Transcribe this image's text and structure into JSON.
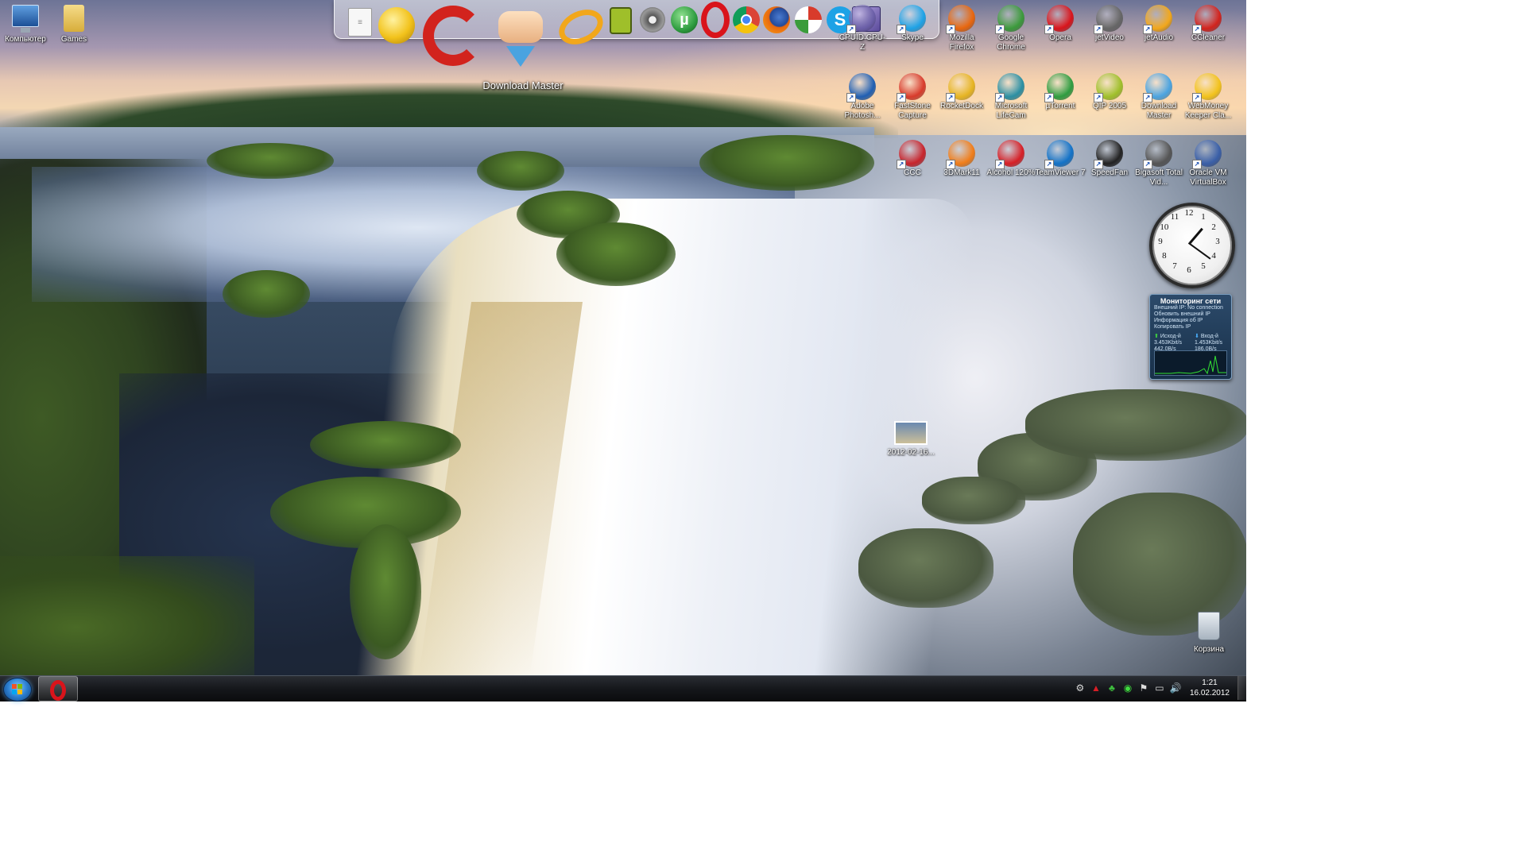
{
  "desktop": {
    "left_icons": [
      {
        "label": "Компьютер",
        "icon": "computer-icon"
      },
      {
        "label": "Games",
        "icon": "folder-icon"
      }
    ],
    "grid_icons": [
      {
        "label": "CPUID CPU-Z",
        "icon": "cpuz-icon",
        "color": "#6b5fa8"
      },
      {
        "label": "Skype",
        "icon": "skype-icon",
        "color": "#1da2e6"
      },
      {
        "label": "Mozilla Firefox",
        "icon": "firefox-icon",
        "color": "#e8660d"
      },
      {
        "label": "Google Chrome",
        "icon": "chrome-icon",
        "color": "#3b9a3b"
      },
      {
        "label": "Opera",
        "icon": "opera-icon",
        "color": "#d9141b"
      },
      {
        "label": "jetVideo",
        "icon": "film-reel-icon",
        "color": "#666666"
      },
      {
        "label": "jetAudio",
        "icon": "jetaudio-icon",
        "color": "#f2a71b"
      },
      {
        "label": "CCleaner",
        "icon": "ccleaner-icon",
        "color": "#d2231d"
      },
      {
        "label": "Adobe Photosh...",
        "icon": "photoshop-icon",
        "color": "#1f5fb3"
      },
      {
        "label": "FastStone Capture",
        "icon": "faststone-icon",
        "color": "#d83b2b"
      },
      {
        "label": "RocketDock",
        "icon": "rocketdock-icon",
        "color": "#e6b422"
      },
      {
        "label": "Microsoft LifeCam",
        "icon": "webcam-icon",
        "color": "#2a8fa3"
      },
      {
        "label": "µTorrent",
        "icon": "utorrent-icon",
        "color": "#2e9c3f"
      },
      {
        "label": "QIP 2005",
        "icon": "qip-icon",
        "color": "#9fbf2a"
      },
      {
        "label": "Download Master",
        "icon": "download-master-icon",
        "color": "#4aa3e0"
      },
      {
        "label": "WebMoney Keeper Cla...",
        "icon": "webmoney-icon",
        "color": "#f2c21b"
      },
      {
        "label": "CCC",
        "icon": "ccc-icon",
        "color": "#c8242c"
      },
      {
        "label": "3DMark11",
        "icon": "3dmark-icon",
        "color": "#f07d1a"
      },
      {
        "label": "Alcohol 120%",
        "icon": "alcohol-icon",
        "color": "#d61f26"
      },
      {
        "label": "TeamViewer 7",
        "icon": "teamviewer-icon",
        "color": "#1372c7"
      },
      {
        "label": "SpeedFan",
        "icon": "fan-icon",
        "color": "#222222"
      },
      {
        "label": "Bigasoft Total Vid...",
        "icon": "film-reel-icon",
        "color": "#555555"
      },
      {
        "label": "Oracle VM VirtualBox",
        "icon": "virtualbox-icon",
        "color": "#3a5fa8"
      }
    ],
    "file_icon": {
      "label": "2012-02-16...",
      "icon": "image-file-icon"
    },
    "recycle_bin": {
      "label": "Корзина",
      "icon": "recycle-bin-icon"
    }
  },
  "dock": {
    "hover_label": "Download Master",
    "items": [
      {
        "name": "notepad",
        "icon": "notepad-icon"
      },
      {
        "name": "webmoney",
        "icon": "webmoney-icon"
      },
      {
        "name": "ccleaner",
        "icon": "ccleaner-icon"
      },
      {
        "name": "download-master",
        "icon": "download-master-icon"
      },
      {
        "name": "jetaudio",
        "icon": "jetaudio-icon"
      },
      {
        "name": "qip",
        "icon": "qip-icon"
      },
      {
        "name": "jetvideo",
        "icon": "film-reel-icon"
      },
      {
        "name": "utorrent",
        "icon": "utorrent-icon"
      },
      {
        "name": "opera",
        "icon": "opera-icon"
      },
      {
        "name": "chrome",
        "icon": "chrome-icon"
      },
      {
        "name": "firefox",
        "icon": "firefox-icon"
      },
      {
        "name": "faststone",
        "icon": "faststone-icon"
      },
      {
        "name": "skype",
        "icon": "skype-icon"
      },
      {
        "name": "cpuz",
        "icon": "cpuz-icon"
      }
    ]
  },
  "gadgets": {
    "clock": {
      "numbers": [
        "12",
        "1",
        "2",
        "3",
        "4",
        "5",
        "6",
        "7",
        "8",
        "9",
        "10",
        "11"
      ],
      "time": "1:21"
    },
    "network_monitor": {
      "title": "Мониторинг сети",
      "lines": [
        "Внешний IP: No connection",
        "Обновить внешний IP",
        "Информация об IP",
        "Копировать IP"
      ],
      "out_label": "Исход-й",
      "out_rate": "3.453Kbit/s",
      "out_bytes": "442.0B/s",
      "in_label": "Вход-й",
      "in_rate": "1.453Kbit/s",
      "in_bytes": "186.0B/s"
    }
  },
  "taskbar": {
    "pinned": [
      {
        "name": "opera",
        "icon": "opera-icon"
      }
    ],
    "tray_icons": [
      "gear-icon",
      "alcohol-tray-icon",
      "clover-icon",
      "network-green-icon",
      "flag-icon",
      "display-icon",
      "speaker-icon"
    ],
    "time": "1:21",
    "date": "16.02.2012"
  }
}
